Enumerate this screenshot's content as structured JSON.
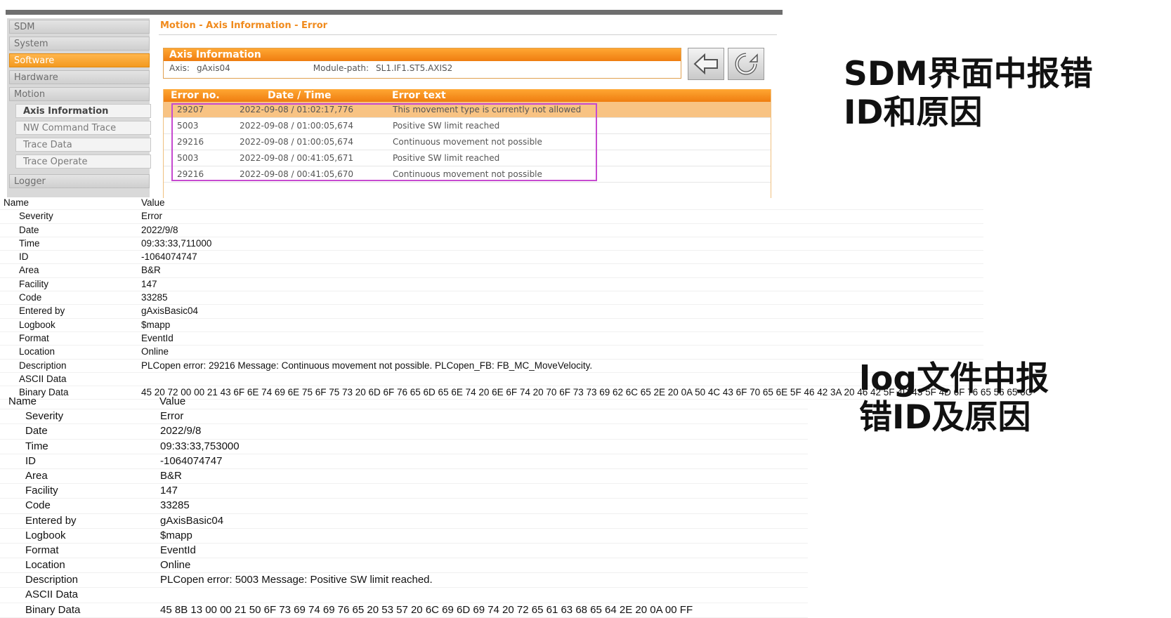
{
  "sdm": {
    "nav_items": [
      "SDM",
      "System",
      "Software",
      "Hardware",
      "Motion"
    ],
    "nav_sub_items": [
      "Axis Information",
      "NW Command Trace",
      "Trace Data",
      "Trace Operate"
    ],
    "nav_logger": "Logger",
    "page_title": "Motion - Axis Information - Error",
    "axis_panel": {
      "title": "Axis Information",
      "axis_label": "Axis:",
      "axis_value": "gAxis04",
      "module_path_label": "Module-path:",
      "module_path_value": "SL1.IF1.ST5.AXIS2"
    },
    "error_table": {
      "headers": [
        "Error no.",
        "Date / Time",
        "Error text"
      ],
      "rows": [
        {
          "no": "29207",
          "datetime": "2022-09-08 / 01:02:17,776",
          "text": "This movement type is currently not allowed"
        },
        {
          "no": "5003",
          "datetime": "2022-09-08 / 01:00:05,674",
          "text": "Positive SW limit reached"
        },
        {
          "no": "29216",
          "datetime": "2022-09-08 / 01:00:05,674",
          "text": "Continuous movement not possible"
        },
        {
          "no": "5003",
          "datetime": "2022-09-08 / 00:41:05,671",
          "text": "Positive SW limit reached"
        },
        {
          "no": "29216",
          "datetime": "2022-09-08 / 00:41:05,670",
          "text": "Continuous movement not possible"
        }
      ]
    },
    "colors": {
      "accent": "#f08a1c",
      "highlight_box": "#c64ad0",
      "selected_row": "#f8c383"
    }
  },
  "log1": {
    "header": {
      "name": "Name",
      "value": "Value"
    },
    "rows": [
      {
        "name": "Severity",
        "value": "Error"
      },
      {
        "name": "Date",
        "value": "2022/9/8"
      },
      {
        "name": "Time",
        "value": "09:33:33,711000"
      },
      {
        "name": "ID",
        "value": "-1064074747"
      },
      {
        "name": "Area",
        "value": "B&R"
      },
      {
        "name": "Facility",
        "value": "147"
      },
      {
        "name": "Code",
        "value": "33285"
      },
      {
        "name": "Entered by",
        "value": "gAxisBasic04"
      },
      {
        "name": "Logbook",
        "value": "$mapp"
      },
      {
        "name": "Format",
        "value": "EventId"
      },
      {
        "name": "Location",
        "value": "Online"
      },
      {
        "name": "Description",
        "value": "PLCopen error: 29216 Message: Continuous movement not possible. PLCopen_FB: FB_MC_MoveVelocity."
      },
      {
        "name": "ASCII Data",
        "value": ""
      },
      {
        "name": "Binary Data",
        "value": "45 20 72 00 00 21 43 6F 6E 74 69 6E 75 6F 75 73 20 6D 6F 76 65 6D 65 6E 74 20 6E 6F 74 20 70 6F 73 73 69 62 6C 65 2E 20 0A 50 4C 43 6F 70 65 6E 5F 46 42 3A 20 46 42 5F 4D 43 5F 4D 6F 76 65 56 65 6C"
      }
    ]
  },
  "log2": {
    "header": {
      "name": "Name",
      "value": "Value"
    },
    "rows": [
      {
        "name": "Severity",
        "value": "Error"
      },
      {
        "name": "Date",
        "value": "2022/9/8"
      },
      {
        "name": "Time",
        "value": "09:33:33,753000"
      },
      {
        "name": "ID",
        "value": "-1064074747"
      },
      {
        "name": "Area",
        "value": "B&R"
      },
      {
        "name": "Facility",
        "value": "147"
      },
      {
        "name": "Code",
        "value": "33285"
      },
      {
        "name": "Entered by",
        "value": "gAxisBasic04"
      },
      {
        "name": "Logbook",
        "value": "$mapp"
      },
      {
        "name": "Format",
        "value": "EventId"
      },
      {
        "name": "Location",
        "value": "Online"
      },
      {
        "name": "Description",
        "value": "PLCopen error: 5003 Message: Positive SW limit reached."
      },
      {
        "name": "ASCII Data",
        "value": ""
      },
      {
        "name": "Binary Data",
        "value": "45 8B 13 00 00 21 50 6F 73 69 74 69 76 65 20 53 57 20 6C 69 6D 69 74 20 72 65 61 63 68 65 64 2E 20 0A 00 FF"
      }
    ]
  },
  "annotations": {
    "sdm_line1": "SDM界面中报错",
    "sdm_line2": "ID和原因",
    "log_line1": "log文件中报",
    "log_line2": "错ID及原因"
  }
}
